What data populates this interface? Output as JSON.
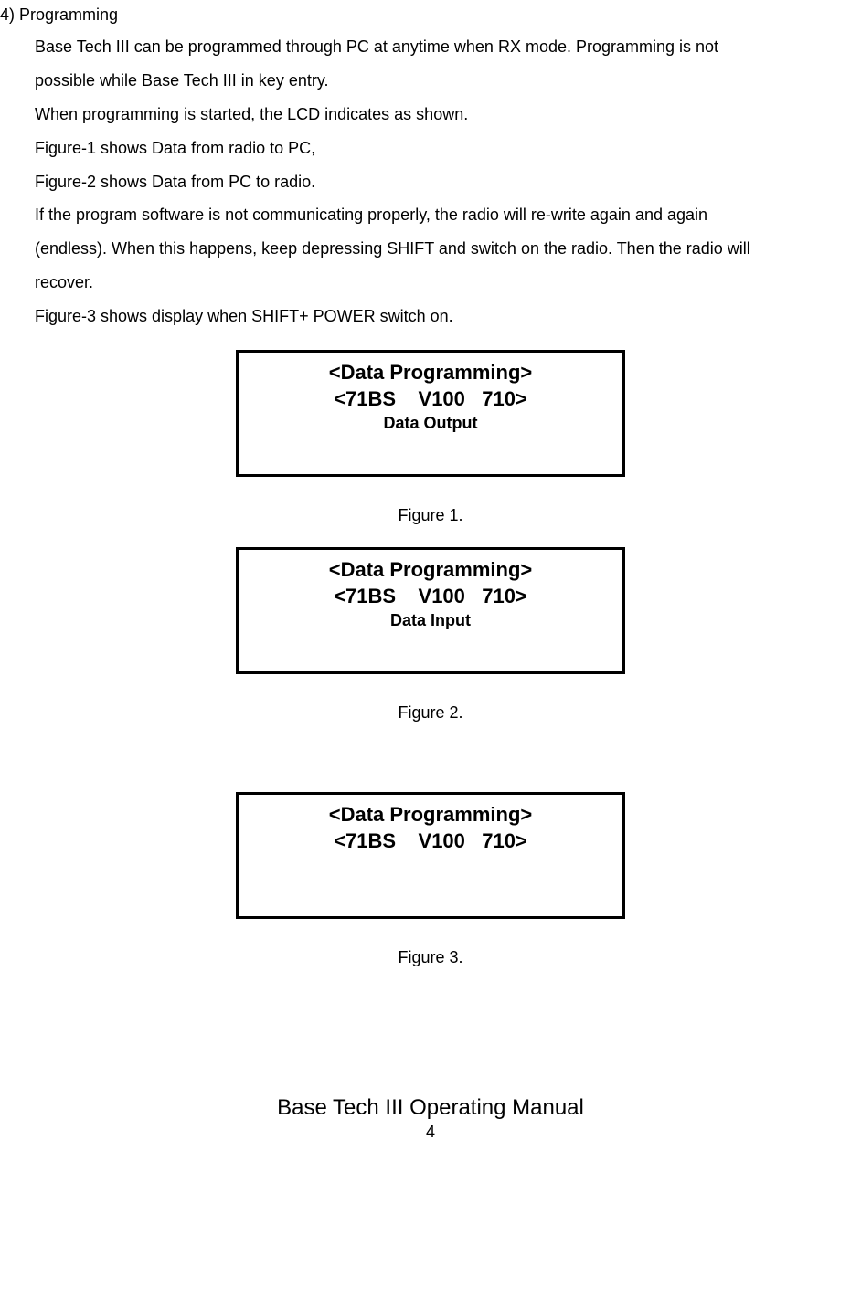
{
  "section_heading": "4) Programming",
  "body_lines": [
    "Base Tech III can be programmed through PC at anytime when RX mode. Programming is not",
    "possible while Base Tech III in key entry.",
    "When programming is started, the LCD indicates as shown.",
    "Figure-1 shows Data from radio to PC,",
    "Figure-2 shows Data from PC to radio.",
    "If the program software is not communicating properly, the radio will re-write again and again",
    "(endless). When this happens, keep depressing SHIFT and switch on the radio. Then the radio will",
    "recover.",
    "Figure-3 shows display when SHIFT+ POWER switch on."
  ],
  "figures": [
    {
      "line1": "<Data Programming>",
      "line2": "<71BS    V100   710>",
      "line3": "Data Output",
      "caption": "Figure 1."
    },
    {
      "line1": "<Data Programming>",
      "line2": "<71BS    V100   710>",
      "line3": "Data Input",
      "caption": "Figure 2."
    },
    {
      "line1": "<Data Programming>",
      "line2": "<71BS    V100   710>",
      "line3": "",
      "caption": "Figure 3."
    }
  ],
  "footer_title": "Base Tech III Operating Manual",
  "footer_page": "4"
}
